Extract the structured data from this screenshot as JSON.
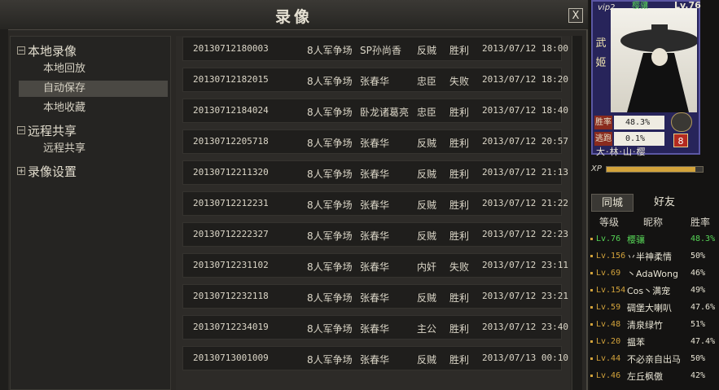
{
  "dialog": {
    "title": "录像",
    "close_label": "X"
  },
  "tree": {
    "groups": [
      {
        "toggle": "−",
        "label": "本地录像",
        "items": [
          "本地回放",
          "自动保存",
          "本地收藏"
        ]
      },
      {
        "toggle": "−",
        "label": "远程共享",
        "items": [
          "远程共享"
        ]
      },
      {
        "toggle": "+",
        "label": "录像设置",
        "items": []
      }
    ],
    "selected_item": "自动保存"
  },
  "recordings": [
    {
      "id": "20130712180003",
      "mode": "8人军争场",
      "hero": "SP孙尚香",
      "role": "反贼",
      "result": "胜利",
      "time": "2013/07/12 18:00"
    },
    {
      "id": "20130712182015",
      "mode": "8人军争场",
      "hero": "张春华",
      "role": "忠臣",
      "result": "失败",
      "time": "2013/07/12 18:20"
    },
    {
      "id": "20130712184024",
      "mode": "8人军争场",
      "hero": "卧龙诸葛亮",
      "role": "忠臣",
      "result": "胜利",
      "time": "2013/07/12 18:40"
    },
    {
      "id": "20130712205718",
      "mode": "8人军争场",
      "hero": "张春华",
      "role": "反贼",
      "result": "胜利",
      "time": "2013/07/12 20:57"
    },
    {
      "id": "20130712211320",
      "mode": "8人军争场",
      "hero": "张春华",
      "role": "反贼",
      "result": "胜利",
      "time": "2013/07/12 21:13"
    },
    {
      "id": "20130712212231",
      "mode": "8人军争场",
      "hero": "张春华",
      "role": "反贼",
      "result": "胜利",
      "time": "2013/07/12 21:22"
    },
    {
      "id": "20130712222327",
      "mode": "8人军争场",
      "hero": "张春华",
      "role": "反贼",
      "result": "胜利",
      "time": "2013/07/12 22:23"
    },
    {
      "id": "20130712231102",
      "mode": "8人军争场",
      "hero": "张春华",
      "role": "内奸",
      "result": "失败",
      "time": "2013/07/12 23:11"
    },
    {
      "id": "20130712232118",
      "mode": "8人军争场",
      "hero": "张春华",
      "role": "反贼",
      "result": "胜利",
      "time": "2013/07/12 23:21"
    },
    {
      "id": "20130712234019",
      "mode": "8人军争场",
      "hero": "张春华",
      "role": "主公",
      "result": "胜利",
      "time": "2013/07/12 23:40"
    },
    {
      "id": "20130713001009",
      "mode": "8人军争场",
      "hero": "张春华",
      "role": "反贼",
      "result": "胜利",
      "time": "2013/07/13 00:10"
    }
  ],
  "profile": {
    "top_label": "樱骧",
    "vip": "vip2",
    "level": "Lv.76",
    "card_name_chars": [
      "武",
      "姬"
    ],
    "win_rate_label": "胜率",
    "win_rate": "48.3%",
    "escape_label": "逃跑",
    "escape_rate": "0.1%",
    "rank": "8",
    "footer": "大·林·山·樱",
    "xp_label": "XP",
    "xp_fraction": 0.92
  },
  "social": {
    "tabs": [
      "同城",
      "好友"
    ],
    "active_tab": "同城",
    "columns": [
      "等级",
      "昵称",
      "胜率"
    ],
    "friends": [
      {
        "level": "Lv.76",
        "name": "樱骧",
        "rate": "48.3%",
        "level_color": "#57d657",
        "name_color": "#57d657"
      },
      {
        "level": "Lv.156",
        "name": "丷半神柔情",
        "rate": "50%",
        "level_color": "#d3a33b",
        "name_color": "#e8e4d4"
      },
      {
        "level": "Lv.69",
        "name": "丶AdaWong",
        "rate": "46%",
        "level_color": "#d3a33b",
        "name_color": "#e8e4d4"
      },
      {
        "level": "Lv.154",
        "name": "Cos丶满宠",
        "rate": "49%",
        "level_color": "#d3a33b",
        "name_color": "#e8e4d4"
      },
      {
        "level": "Lv.59",
        "name": "碉堡大喇叭",
        "rate": "47.6%",
        "level_color": "#d3a33b",
        "name_color": "#e8e4d4"
      },
      {
        "level": "Lv.48",
        "name": "清泉绿竹",
        "rate": "51%",
        "level_color": "#d3a33b",
        "name_color": "#e8e4d4"
      },
      {
        "level": "Lv.20",
        "name": "揾苯",
        "rate": "47.4%",
        "level_color": "#d3a33b",
        "name_color": "#e8e4d4"
      },
      {
        "level": "Lv.44",
        "name": "不必亲自出马",
        "rate": "50%",
        "level_color": "#d3a33b",
        "name_color": "#e8e4d4"
      },
      {
        "level": "Lv.46",
        "name": "左丘枫傲",
        "rate": "42%",
        "level_color": "#d3a33b",
        "name_color": "#e8e4d4"
      }
    ]
  }
}
